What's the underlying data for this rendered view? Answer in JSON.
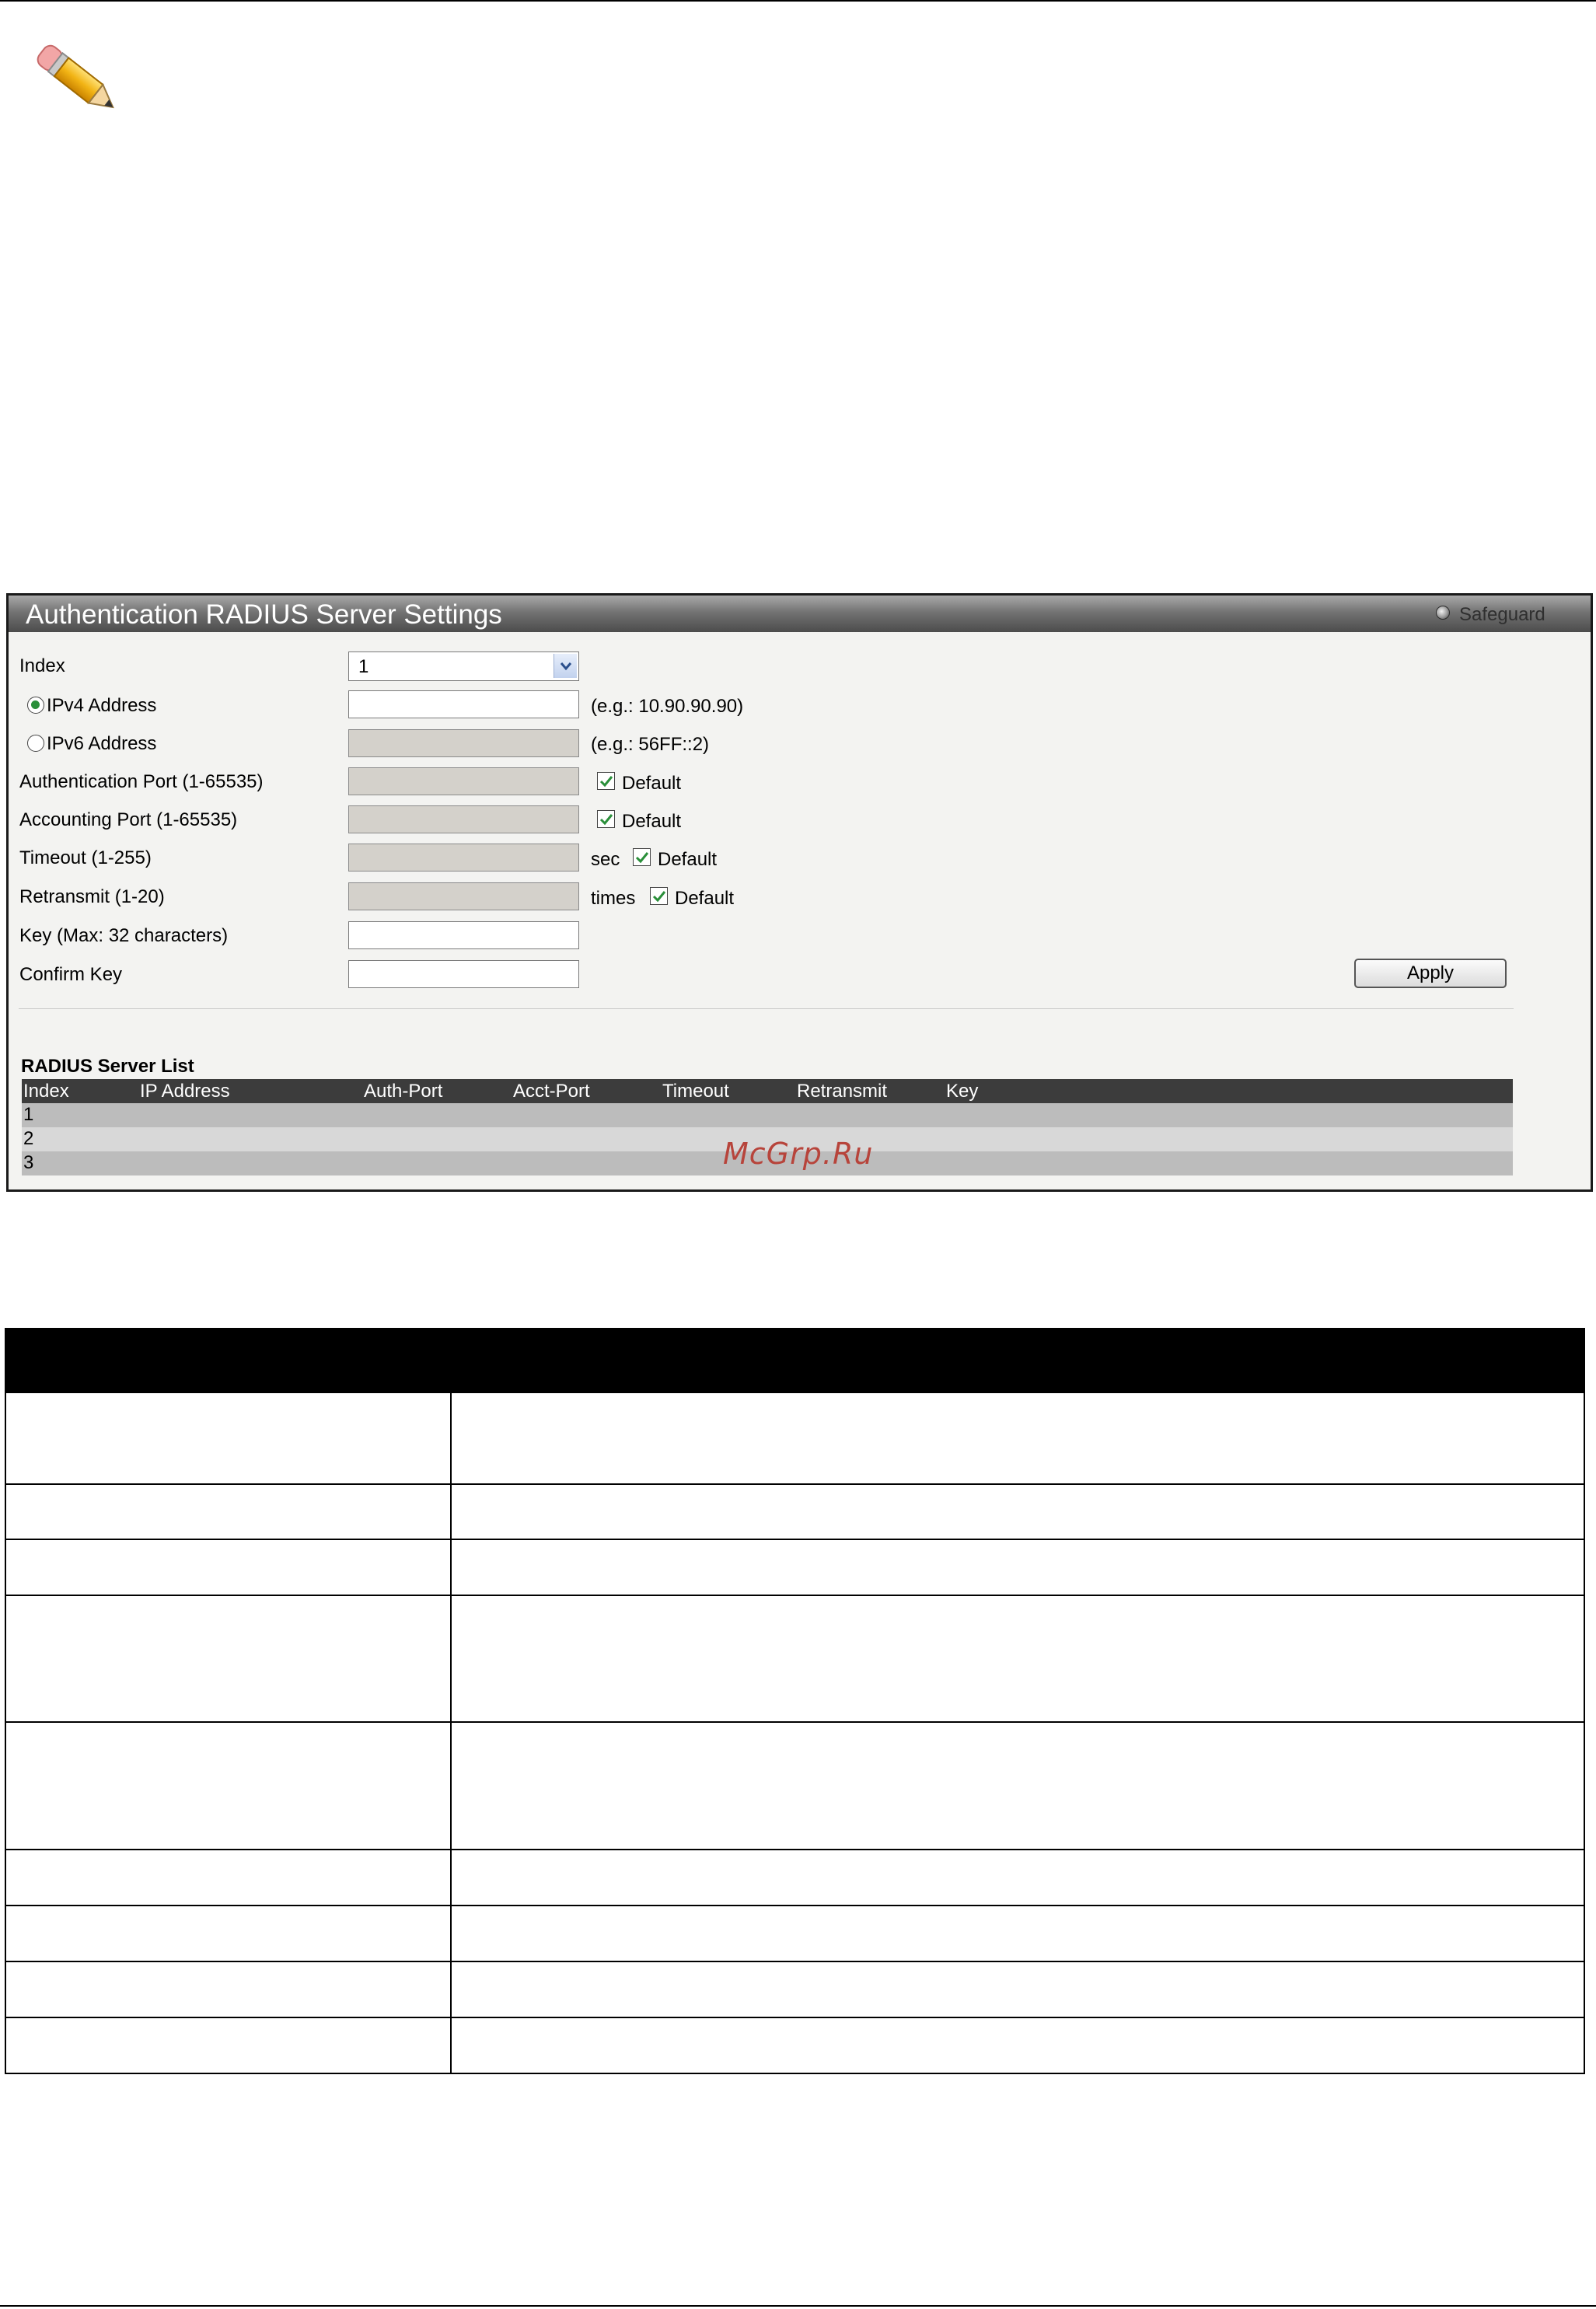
{
  "panel": {
    "title": "Authentication RADIUS Server Settings",
    "safeguard_label": "Safeguard"
  },
  "form": {
    "index_label": "Index",
    "index_value": "1",
    "ipv4_label": "IPv4 Address",
    "ipv4_hint": "(e.g.: 10.90.90.90)",
    "ipv4_selected": true,
    "ipv6_label": "IPv6 Address",
    "ipv6_hint": "(e.g.: 56FF::2)",
    "auth_port_label": "Authentication Port (1-65535)",
    "acct_port_label": "Accounting Port (1-65535)",
    "timeout_label": "Timeout (1-255)",
    "timeout_unit": "sec",
    "retransmit_label": "Retransmit (1-20)",
    "retransmit_unit": "times",
    "default_label": "Default",
    "key_label": "Key (Max: 32 characters)",
    "confirm_key_label": "Confirm Key",
    "apply_label": "Apply"
  },
  "server_list": {
    "title": "RADIUS Server List",
    "columns": [
      "Index",
      "IP Address",
      "Auth-Port",
      "Acct-Port",
      "Timeout",
      "Retransmit",
      "Key"
    ],
    "rows": [
      "1",
      "2",
      "3"
    ]
  },
  "watermark": "McGrp.Ru",
  "colors": {
    "title_bar": "#5a5a5a",
    "list_header": "#3c3c3c",
    "row_dark": "#bcbcbc",
    "row_light": "#d8d8d8",
    "disabled_field": "#d4d1cb",
    "check_green": "#2a8f3a",
    "watermark": "#b7443b"
  }
}
